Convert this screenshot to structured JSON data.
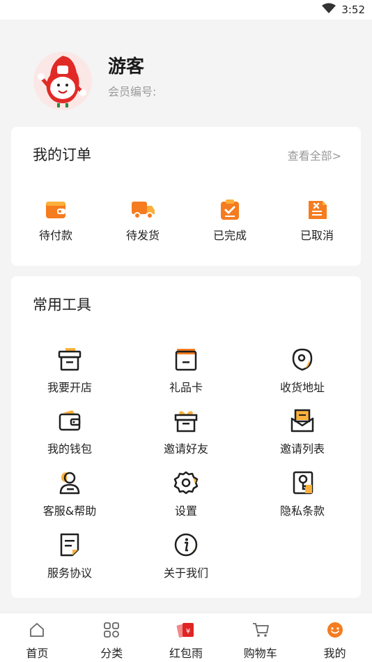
{
  "status_bar": {
    "time": "3:52",
    "icons": [
      "wifi-icon"
    ]
  },
  "profile": {
    "name": "游客",
    "member_label": "会员编号:"
  },
  "orders": {
    "title": "我的订单",
    "view_all": "查看全部>",
    "items": [
      {
        "label": "待付款",
        "icon": "wallet-icon"
      },
      {
        "label": "待发货",
        "icon": "truck-icon"
      },
      {
        "label": "已完成",
        "icon": "clipboard-check-icon"
      },
      {
        "label": "已取消",
        "icon": "document-cancel-icon"
      }
    ]
  },
  "tools": {
    "title": "常用工具",
    "items": [
      {
        "label": "我要开店",
        "icon": "store-box-icon"
      },
      {
        "label": "礼品卡",
        "icon": "gift-card-icon"
      },
      {
        "label": "收货地址",
        "icon": "location-pin-icon"
      },
      {
        "label": "我的钱包",
        "icon": "wallet-outline-icon"
      },
      {
        "label": "邀请好友",
        "icon": "gift-box-icon"
      },
      {
        "label": "邀请列表",
        "icon": "envelope-list-icon"
      },
      {
        "label": "客服&帮助",
        "icon": "customer-service-icon"
      },
      {
        "label": "设置",
        "icon": "settings-gear-icon"
      },
      {
        "label": "隐私条款",
        "icon": "privacy-key-icon"
      },
      {
        "label": "服务协议",
        "icon": "agreement-doc-icon"
      },
      {
        "label": "关于我们",
        "icon": "info-icon"
      }
    ]
  },
  "tabbar": {
    "items": [
      {
        "label": "首页",
        "icon": "home-icon"
      },
      {
        "label": "分类",
        "icon": "category-icon"
      },
      {
        "label": "红包雨",
        "icon": "red-envelope-icon"
      },
      {
        "label": "购物车",
        "icon": "cart-icon"
      },
      {
        "label": "我的",
        "icon": "profile-face-icon",
        "active": true
      }
    ]
  },
  "colors": {
    "accent": "#f57c1f",
    "accent_light": "#fbb03b",
    "background": "#f4f4f5",
    "card": "#ffffff"
  }
}
